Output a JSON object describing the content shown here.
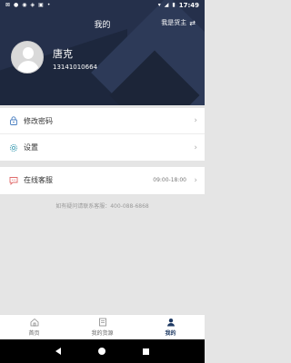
{
  "status_bar": {
    "time": "17:49",
    "left_icons": [
      "⊠",
      "●",
      "◉",
      "◈",
      "▣",
      "•"
    ],
    "right_icons": [
      "▾",
      "◢",
      "▮"
    ]
  },
  "header": {
    "title": "我的",
    "role_switch": "我是货主",
    "swap_icon": "⇄"
  },
  "profile": {
    "name": "唐克",
    "phone": "13141010664"
  },
  "menu": [
    {
      "label": "修改密码",
      "icon": "lock-icon"
    },
    {
      "label": "设置",
      "icon": "gear-icon"
    }
  ],
  "service": {
    "label": "在线客服",
    "hours": "09:00-18:00",
    "icon": "chat-icon"
  },
  "hint": "如有疑问请联系客服：400-088-6868",
  "chevron": "›",
  "tabs": [
    {
      "label": "首页",
      "icon": "home-icon"
    },
    {
      "label": "我的货源",
      "icon": "list-icon"
    },
    {
      "label": "我的",
      "icon": "user-icon",
      "active": true
    }
  ],
  "colors": {
    "header_bg": "#25304b",
    "accent": "#1f3a63",
    "page_bg": "#e5e5e5"
  }
}
